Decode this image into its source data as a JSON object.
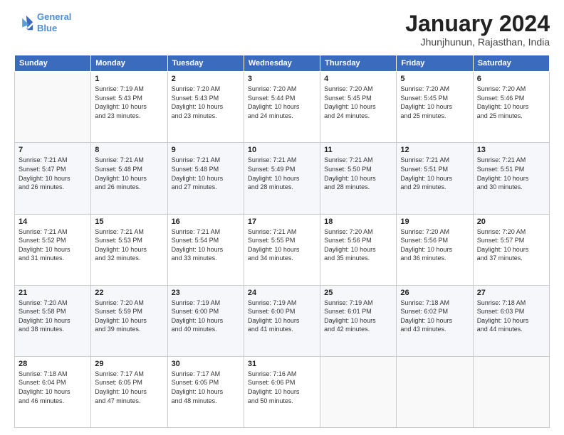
{
  "logo": {
    "line1": "General",
    "line2": "Blue"
  },
  "title": "January 2024",
  "subtitle": "Jhunjhunun, Rajasthan, India",
  "weekdays": [
    "Sunday",
    "Monday",
    "Tuesday",
    "Wednesday",
    "Thursday",
    "Friday",
    "Saturday"
  ],
  "weeks": [
    [
      {
        "day": "",
        "info": ""
      },
      {
        "day": "1",
        "info": "Sunrise: 7:19 AM\nSunset: 5:43 PM\nDaylight: 10 hours\nand 23 minutes."
      },
      {
        "day": "2",
        "info": "Sunrise: 7:20 AM\nSunset: 5:43 PM\nDaylight: 10 hours\nand 23 minutes."
      },
      {
        "day": "3",
        "info": "Sunrise: 7:20 AM\nSunset: 5:44 PM\nDaylight: 10 hours\nand 24 minutes."
      },
      {
        "day": "4",
        "info": "Sunrise: 7:20 AM\nSunset: 5:45 PM\nDaylight: 10 hours\nand 24 minutes."
      },
      {
        "day": "5",
        "info": "Sunrise: 7:20 AM\nSunset: 5:45 PM\nDaylight: 10 hours\nand 25 minutes."
      },
      {
        "day": "6",
        "info": "Sunrise: 7:20 AM\nSunset: 5:46 PM\nDaylight: 10 hours\nand 25 minutes."
      }
    ],
    [
      {
        "day": "7",
        "info": "Sunrise: 7:21 AM\nSunset: 5:47 PM\nDaylight: 10 hours\nand 26 minutes."
      },
      {
        "day": "8",
        "info": "Sunrise: 7:21 AM\nSunset: 5:48 PM\nDaylight: 10 hours\nand 26 minutes."
      },
      {
        "day": "9",
        "info": "Sunrise: 7:21 AM\nSunset: 5:48 PM\nDaylight: 10 hours\nand 27 minutes."
      },
      {
        "day": "10",
        "info": "Sunrise: 7:21 AM\nSunset: 5:49 PM\nDaylight: 10 hours\nand 28 minutes."
      },
      {
        "day": "11",
        "info": "Sunrise: 7:21 AM\nSunset: 5:50 PM\nDaylight: 10 hours\nand 28 minutes."
      },
      {
        "day": "12",
        "info": "Sunrise: 7:21 AM\nSunset: 5:51 PM\nDaylight: 10 hours\nand 29 minutes."
      },
      {
        "day": "13",
        "info": "Sunrise: 7:21 AM\nSunset: 5:51 PM\nDaylight: 10 hours\nand 30 minutes."
      }
    ],
    [
      {
        "day": "14",
        "info": "Sunrise: 7:21 AM\nSunset: 5:52 PM\nDaylight: 10 hours\nand 31 minutes."
      },
      {
        "day": "15",
        "info": "Sunrise: 7:21 AM\nSunset: 5:53 PM\nDaylight: 10 hours\nand 32 minutes."
      },
      {
        "day": "16",
        "info": "Sunrise: 7:21 AM\nSunset: 5:54 PM\nDaylight: 10 hours\nand 33 minutes."
      },
      {
        "day": "17",
        "info": "Sunrise: 7:21 AM\nSunset: 5:55 PM\nDaylight: 10 hours\nand 34 minutes."
      },
      {
        "day": "18",
        "info": "Sunrise: 7:20 AM\nSunset: 5:56 PM\nDaylight: 10 hours\nand 35 minutes."
      },
      {
        "day": "19",
        "info": "Sunrise: 7:20 AM\nSunset: 5:56 PM\nDaylight: 10 hours\nand 36 minutes."
      },
      {
        "day": "20",
        "info": "Sunrise: 7:20 AM\nSunset: 5:57 PM\nDaylight: 10 hours\nand 37 minutes."
      }
    ],
    [
      {
        "day": "21",
        "info": "Sunrise: 7:20 AM\nSunset: 5:58 PM\nDaylight: 10 hours\nand 38 minutes."
      },
      {
        "day": "22",
        "info": "Sunrise: 7:20 AM\nSunset: 5:59 PM\nDaylight: 10 hours\nand 39 minutes."
      },
      {
        "day": "23",
        "info": "Sunrise: 7:19 AM\nSunset: 6:00 PM\nDaylight: 10 hours\nand 40 minutes."
      },
      {
        "day": "24",
        "info": "Sunrise: 7:19 AM\nSunset: 6:00 PM\nDaylight: 10 hours\nand 41 minutes."
      },
      {
        "day": "25",
        "info": "Sunrise: 7:19 AM\nSunset: 6:01 PM\nDaylight: 10 hours\nand 42 minutes."
      },
      {
        "day": "26",
        "info": "Sunrise: 7:18 AM\nSunset: 6:02 PM\nDaylight: 10 hours\nand 43 minutes."
      },
      {
        "day": "27",
        "info": "Sunrise: 7:18 AM\nSunset: 6:03 PM\nDaylight: 10 hours\nand 44 minutes."
      }
    ],
    [
      {
        "day": "28",
        "info": "Sunrise: 7:18 AM\nSunset: 6:04 PM\nDaylight: 10 hours\nand 46 minutes."
      },
      {
        "day": "29",
        "info": "Sunrise: 7:17 AM\nSunset: 6:05 PM\nDaylight: 10 hours\nand 47 minutes."
      },
      {
        "day": "30",
        "info": "Sunrise: 7:17 AM\nSunset: 6:05 PM\nDaylight: 10 hours\nand 48 minutes."
      },
      {
        "day": "31",
        "info": "Sunrise: 7:16 AM\nSunset: 6:06 PM\nDaylight: 10 hours\nand 50 minutes."
      },
      {
        "day": "",
        "info": ""
      },
      {
        "day": "",
        "info": ""
      },
      {
        "day": "",
        "info": ""
      }
    ]
  ]
}
